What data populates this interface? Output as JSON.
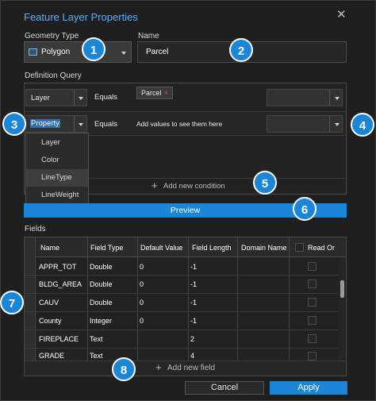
{
  "dialog": {
    "title": "Feature Layer Properties"
  },
  "geometry": {
    "label": "Geometry Type",
    "value": "Polygon"
  },
  "name": {
    "label": "Name",
    "value": "Parcel"
  },
  "definition_query": {
    "label": "Definition Query",
    "row1": {
      "field": "Layer",
      "operator": "Equals",
      "chip": "Parcel"
    },
    "row2": {
      "field": "Property",
      "operator": "Equals",
      "hint": "Add values to see them here"
    },
    "dropdown_options": [
      "Layer",
      "Color",
      "LineType",
      "LineWeight"
    ],
    "add_condition": "Add new condition"
  },
  "preview_label": "Preview",
  "fields": {
    "label": "Fields",
    "columns": [
      "Name",
      "Field Type",
      "Default Value",
      "Field Length",
      "Domain Name",
      "Read Or"
    ],
    "rows": [
      {
        "name": "APPR_TOT",
        "type": "Double",
        "default": "0",
        "length": "-1"
      },
      {
        "name": "BLDG_AREA",
        "type": "Double",
        "default": "0",
        "length": "-1"
      },
      {
        "name": "CAUV",
        "type": "Double",
        "default": "0",
        "length": "-1"
      },
      {
        "name": "County",
        "type": "Integer",
        "default": "0",
        "length": "-1"
      },
      {
        "name": "FIREPLACE",
        "type": "Text",
        "default": "",
        "length": "2"
      },
      {
        "name": "GRADE",
        "type": "Text",
        "default": "",
        "length": "4"
      }
    ],
    "add_field": "Add new field"
  },
  "buttons": {
    "cancel": "Cancel",
    "apply": "Apply"
  },
  "callouts": [
    "1",
    "2",
    "3",
    "4",
    "5",
    "6",
    "7",
    "8"
  ],
  "colors": {
    "accent": "#1a86d8",
    "title": "#56b0ff"
  }
}
